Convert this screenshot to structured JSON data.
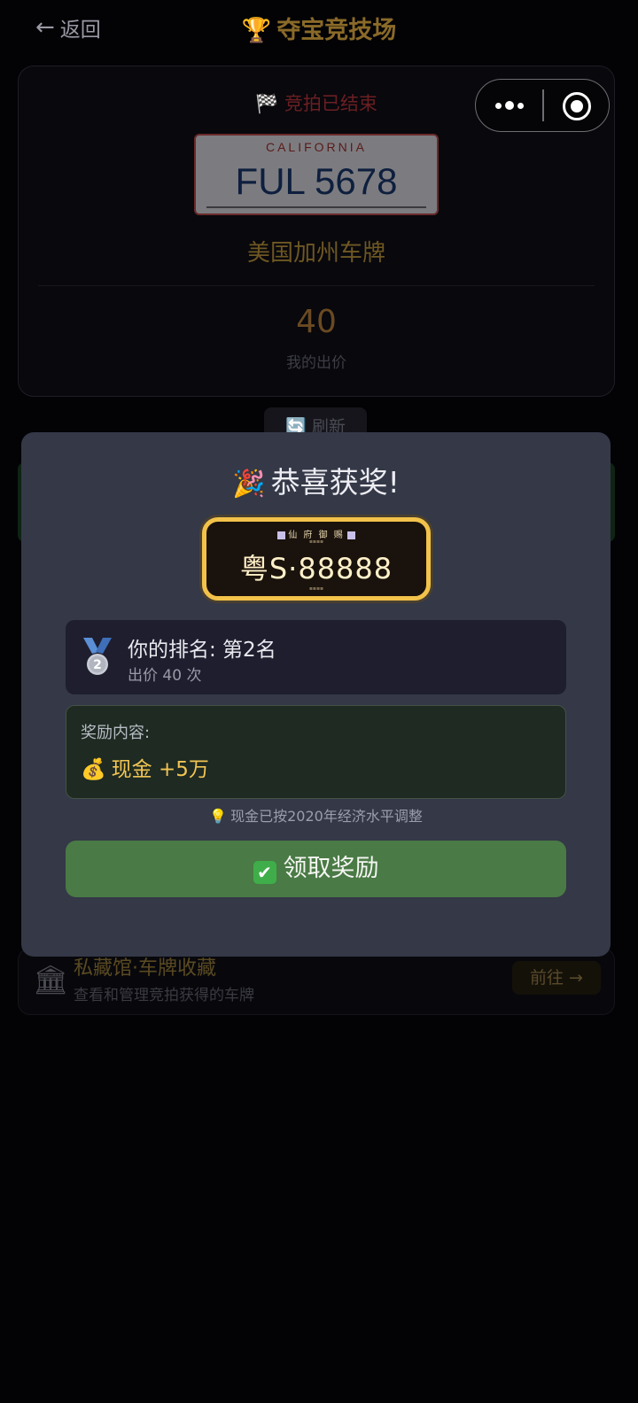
{
  "header": {
    "back_label": "返回",
    "back_arrow": "←",
    "title": "夺宝竞技场",
    "title_icon": "🏆"
  },
  "auction": {
    "status": "竞拍已结束",
    "status_icon": "🏁",
    "plate_state": "CALIFORNIA",
    "plate_number": "FUL 5678",
    "plate_name": "美国加州车牌",
    "bid_count": "40",
    "bid_label": "我的出价",
    "refresh_label": "刷新",
    "refresh_icon": "🔄"
  },
  "vault": {
    "icon": "🏛",
    "title": "私藏馆·车牌收藏",
    "subtitle": "查看和管理竞拍获得的车牌",
    "go_label": "前往 →"
  },
  "modal": {
    "title": "恭喜获奖!",
    "title_icon": "🎉",
    "prize_plate_top": "仙 府 御 赐",
    "prize_plate_number": "粤S·88888",
    "rank_text": "你的排名: 第2名",
    "rank_medal": "2",
    "bid_times": "出价 40 次",
    "reward_label": "奖励内容:",
    "reward_icon": "💰",
    "reward_value": "现金 +5万",
    "note_icon": "💡",
    "note": "现金已按2020年经济水平调整",
    "claim_icon": "✔",
    "claim_label": "领取奖励"
  },
  "colors": {
    "background": "#030306",
    "modal": "#343847",
    "accent_gold": "#f1c453",
    "claim_green": "#4a7a45"
  }
}
